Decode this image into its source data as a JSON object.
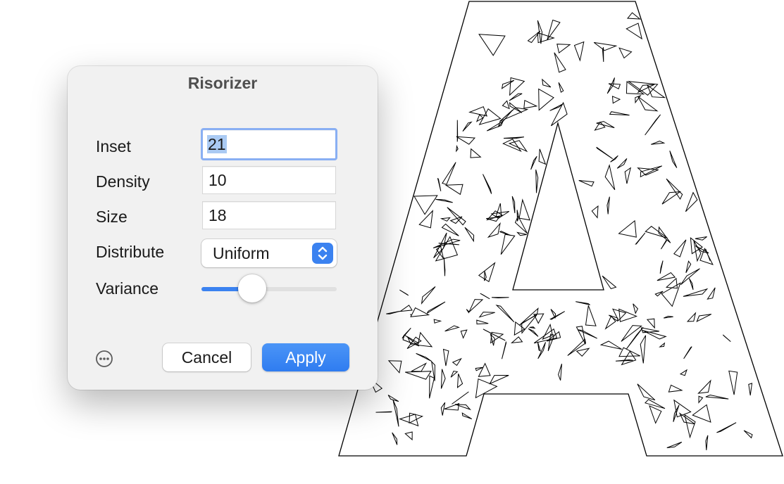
{
  "dialog": {
    "title": "Risorizer",
    "fields": {
      "inset": {
        "label": "Inset",
        "value": "21"
      },
      "density": {
        "label": "Density",
        "value": "10"
      },
      "size": {
        "label": "Size",
        "value": "18"
      }
    },
    "distribute": {
      "label": "Distribute",
      "selected": "Uniform"
    },
    "variance": {
      "label": "Variance",
      "value_fraction": 0.34
    },
    "buttons": {
      "more_icon": "ellipsis-circle-icon",
      "cancel": "Cancel",
      "apply": "Apply"
    }
  },
  "artwork": {
    "shape": "letter-A-outline",
    "fragments": 240,
    "seed": 21
  },
  "colors": {
    "accent": "#3b82f0",
    "dialog_background": "#f1f1f1",
    "focus_ring": "#89aff3",
    "selection": "#aacaf3"
  }
}
